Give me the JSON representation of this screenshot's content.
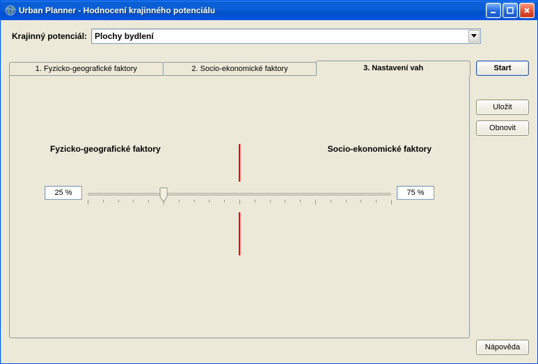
{
  "window": {
    "title": "Urban Planner  - Hodnocení krajinného potenciálu",
    "app_icon": "globe-icon"
  },
  "toprow": {
    "label": "Krajinný potenciál:",
    "dropdown_value": "Plochy bydlení"
  },
  "buttons": {
    "start": "Start",
    "save": "Uložit",
    "restore": "Obnovit",
    "help": "Nápověda"
  },
  "tabs": [
    {
      "label": "1. Fyzicko-geografické faktory",
      "active": false
    },
    {
      "label": "2. Socio-ekonomické faktory",
      "active": false
    },
    {
      "label": "3. Nastavení vah",
      "active": true
    }
  ],
  "weights": {
    "left_label": "Fyzicko-geografické faktory",
    "right_label": "Socio-ekonomické faktory",
    "left_pct": "25 %",
    "right_pct": "75 %",
    "slider_value": 25,
    "slider_min": 0,
    "slider_max": 100
  },
  "colors": {
    "titlebar_blue": "#0b5fd6",
    "close_red": "#e8563a",
    "panel_bg": "#ece9d8",
    "marker_red": "#ff0000",
    "dropdown_border": "#7f9db9"
  }
}
